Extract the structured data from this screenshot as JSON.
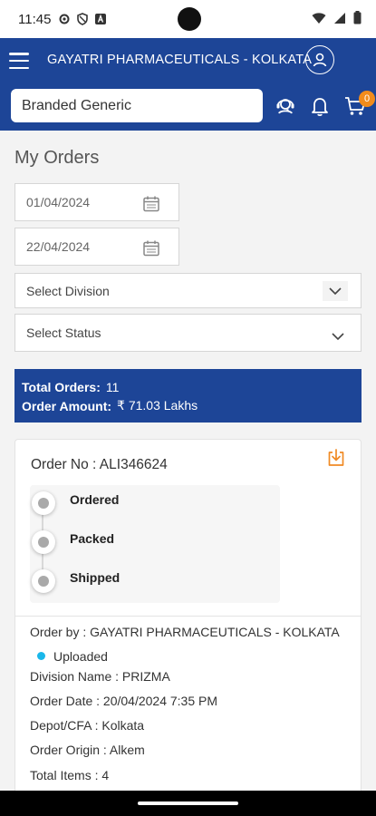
{
  "status_bar": {
    "time": "11:45",
    "left_icons": [
      "gear-icon",
      "shield-icon",
      "text-a-icon"
    ],
    "right_icons": [
      "wifi-icon",
      "signal-icon",
      "battery-icon"
    ]
  },
  "header": {
    "title": "GAYATRI PHARMACEUTICALS - KOLKATA",
    "search_value": "Branded Generic",
    "cart_count": "0",
    "colors": {
      "primary": "#1d4597",
      "badge": "#f28c1c"
    }
  },
  "page": {
    "title": "My Orders"
  },
  "filters": {
    "from_date": "01/04/2024",
    "to_date": "22/04/2024",
    "division_placeholder": "Select Division",
    "status_placeholder": "Select Status"
  },
  "summary": {
    "total_orders_label": "Total Orders:",
    "total_orders_value": "11",
    "order_amount_label": "Order Amount:",
    "order_amount_value": "₹ 71.03 Lakhs"
  },
  "order": {
    "order_no": "Order No : ALI346624",
    "steps": [
      "Ordered",
      "Packed",
      "Shipped"
    ],
    "order_by": "Order by : GAYATRI PHARMACEUTICALS - KOLKATA",
    "status": "Uploaded",
    "status_color": "#1ab7ea",
    "division": "Division Name : PRIZMA",
    "order_date": "Order Date : 20/04/2024 7:35 PM",
    "depot": "Depot/CFA : Kolkata",
    "origin": "Order Origin : Alkem",
    "total_items": "Total Items : 4"
  }
}
